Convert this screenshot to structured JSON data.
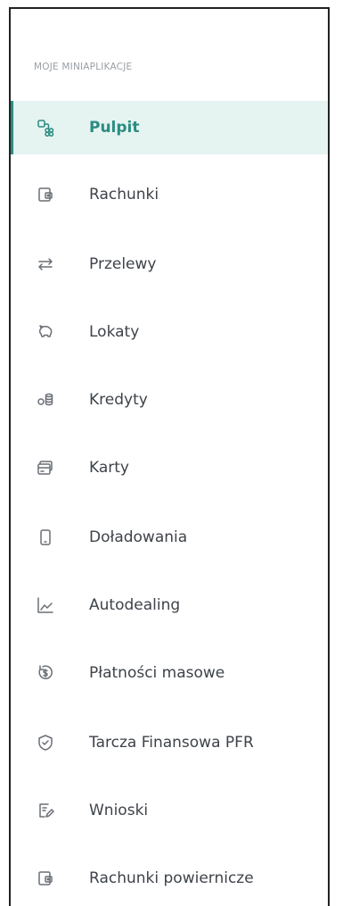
{
  "sidebar": {
    "section_title": "MOJE MINIAPLIKACJE",
    "accent_color": "#2b8c81",
    "active_bg": "#e5f3f1",
    "items": [
      {
        "label": "Pulpit",
        "icon": "dashboard-icon",
        "active": true
      },
      {
        "label": "Rachunki",
        "icon": "accounts-icon",
        "active": false
      },
      {
        "label": "Przelewy",
        "icon": "transfer-arrows-icon",
        "active": false
      },
      {
        "label": "Lokaty",
        "icon": "piggy-bank-icon",
        "active": false
      },
      {
        "label": "Kredyty",
        "icon": "coins-icon",
        "active": false
      },
      {
        "label": "Karty",
        "icon": "card-icon",
        "active": false
      },
      {
        "label": "Doładowania",
        "icon": "phone-icon",
        "active": false
      },
      {
        "label": "Autodealing",
        "icon": "chart-line-icon",
        "active": false
      },
      {
        "label": "Płatności masowe",
        "icon": "money-circle-icon",
        "active": false
      },
      {
        "label": "Tarcza Finansowa PFR",
        "icon": "shield-check-icon",
        "active": false
      },
      {
        "label": "Wnioski",
        "icon": "document-edit-icon",
        "active": false
      },
      {
        "label": "Rachunki powiernicze",
        "icon": "accounts-icon",
        "active": false
      }
    ]
  }
}
